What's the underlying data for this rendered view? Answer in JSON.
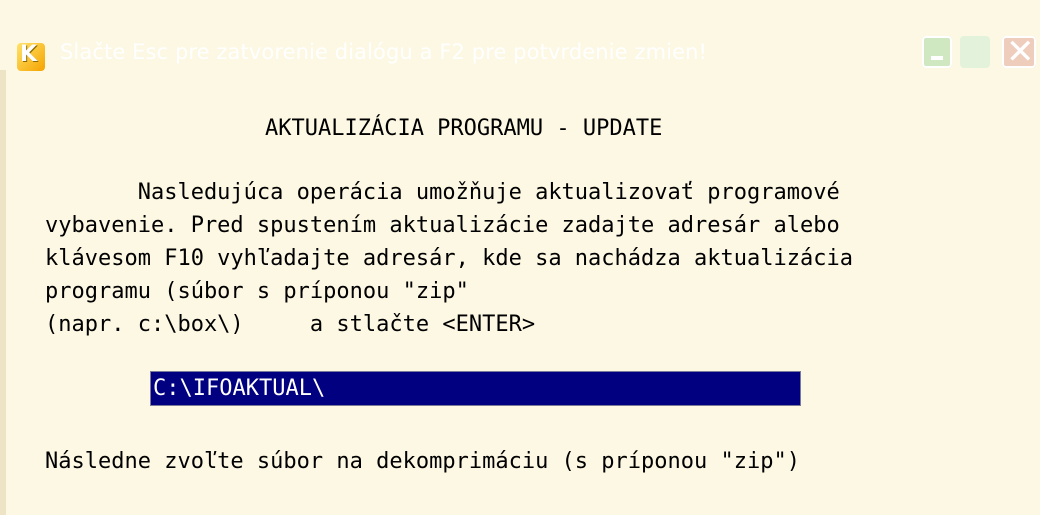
{
  "window": {
    "title": "Slačte Esc pre zatvorenie dialógu a F2 pre potvrdenie zmien!",
    "app_icon_letter": "K",
    "controls": {
      "minimize": "minimize",
      "maximize": "maximize",
      "close": "✕"
    }
  },
  "dialog": {
    "heading": "AKTUALIZÁCIA PROGRAMU - UPDATE",
    "paragraph_lines": [
      "       Nasledujúca operácia umožňuje aktualizovať programové",
      "vybavenie. Pred spustením aktualizácie zadajte adresár alebo",
      "klávesom F10 vyhľadajte adresár, kde sa nachádza aktualizácia",
      "programu (súbor s príponou \"zip\"",
      "(napr. c:\\box\\)     a stlačte <ENTER>"
    ],
    "path_input_value": "C:\\IFOAKTUAL\\",
    "footer": "Následne zvoľte súbor na dekomprimáciu (s príponou \"zip\")"
  },
  "colors": {
    "background": "#fdf8e3",
    "input_background": "#000080",
    "input_text": "#ffffff"
  }
}
